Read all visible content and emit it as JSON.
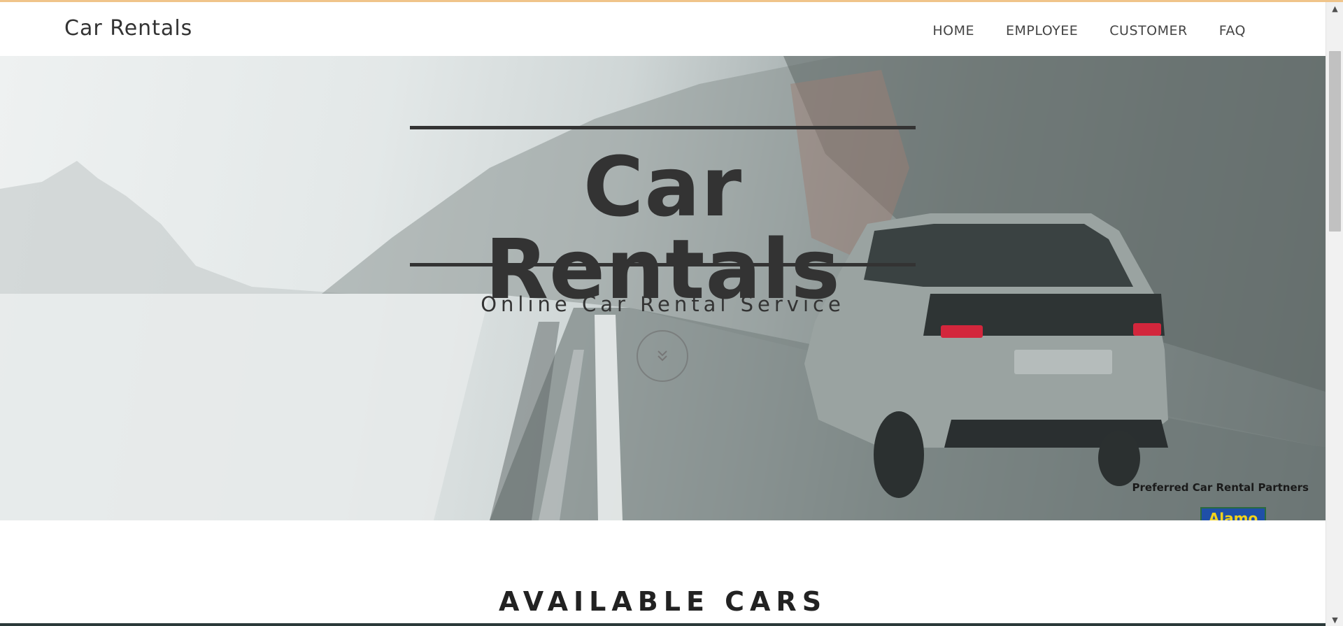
{
  "nav": {
    "brand": "Car Rentals",
    "links": [
      {
        "label": "HOME"
      },
      {
        "label": "EMPLOYEE"
      },
      {
        "label": "CUSTOMER"
      },
      {
        "label": "FAQ"
      }
    ]
  },
  "hero": {
    "title": "Car Rentals",
    "subtitle": "Online Car Rental Service",
    "scroll_icon": "double-chevron-down-icon",
    "partners_label": "Preferred Car Rental Partners",
    "partner_logo_text": "Alamo"
  },
  "section": {
    "heading": "AVAILABLE CARS"
  },
  "colors": {
    "accent_bar": "#f0c48a",
    "text_dark": "#333333",
    "background": "#ffffff"
  }
}
